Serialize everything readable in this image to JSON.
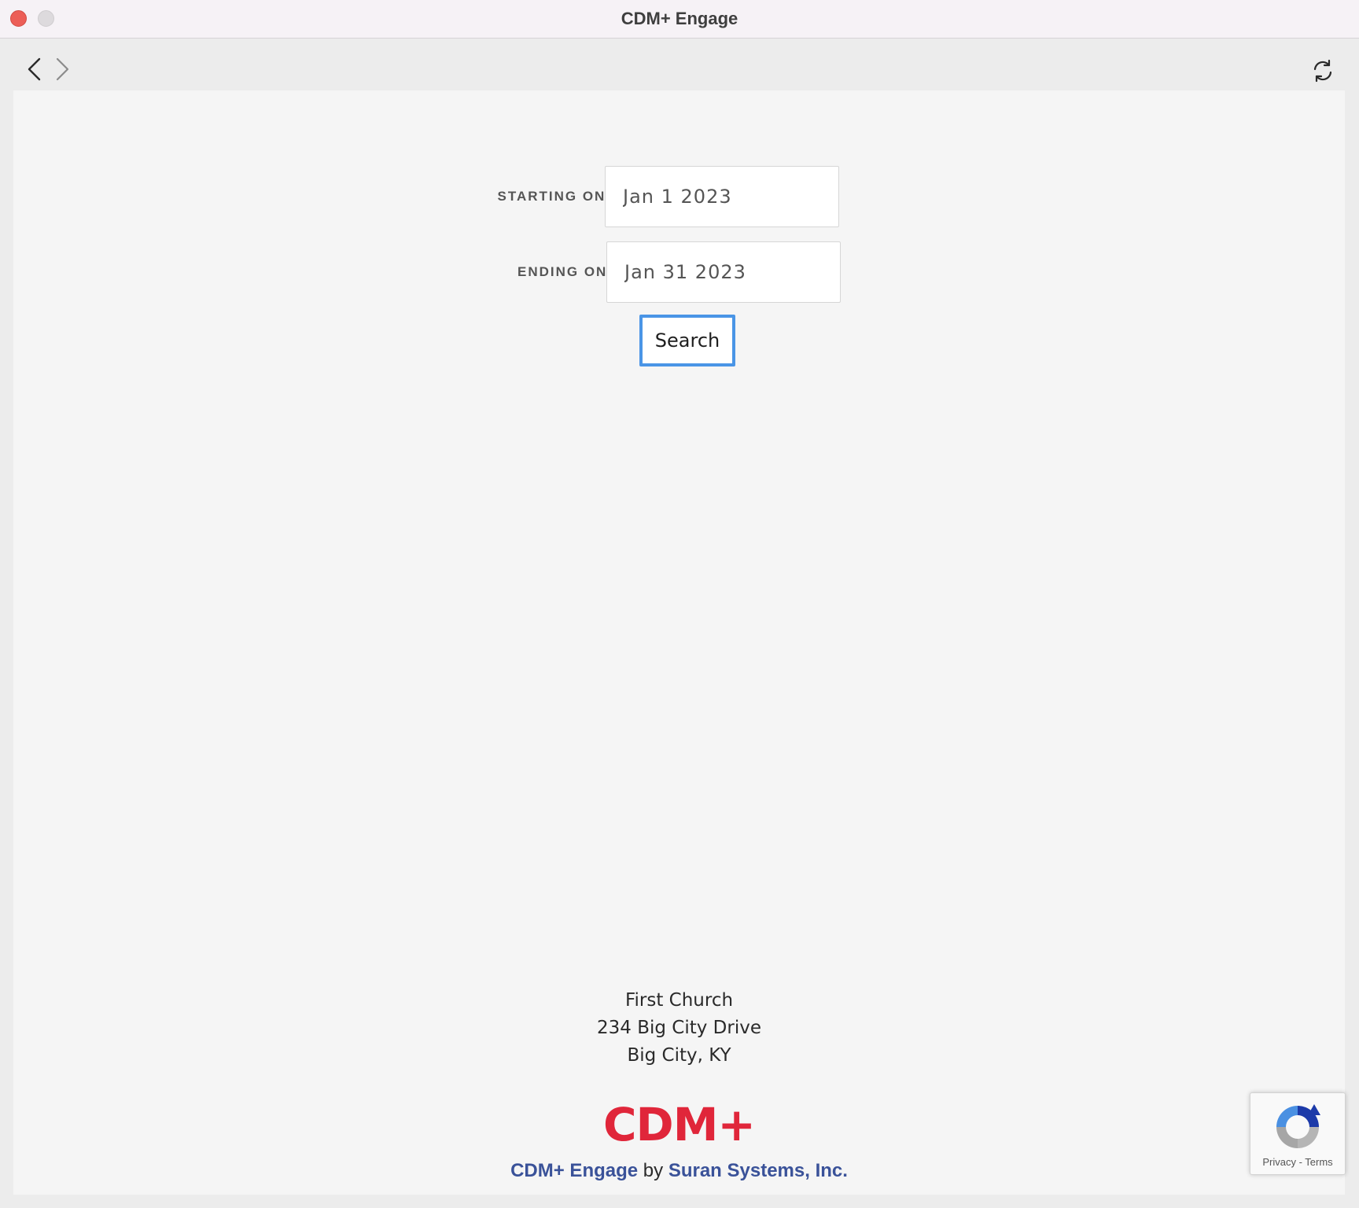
{
  "window": {
    "title": "CDM+ Engage"
  },
  "toolbar": {
    "back_icon": "chevron-left-icon",
    "forward_icon": "chevron-right-icon",
    "reload_icon": "reload-icon"
  },
  "form": {
    "starting_label": "STARTING ON:",
    "starting_value": "Jan 1 2023",
    "ending_label": "ENDING ON:",
    "ending_value": "Jan 31 2023",
    "search_label": "Search"
  },
  "address": {
    "line1": "First Church",
    "line2": "234 Big City Drive",
    "line3": "Big City, KY"
  },
  "footer": {
    "logo_text": "CDM+",
    "product_link": "CDM+ Engage",
    "by": " by ",
    "company_link": "Suran Systems, Inc."
  },
  "recaptcha": {
    "privacy": "Privacy",
    "separator": " - ",
    "terms": "Terms"
  },
  "colors": {
    "accent_focus": "#4a95e6",
    "logo_red": "#e0263a",
    "link_blue": "#3a5299",
    "close_red": "#ec5e57"
  }
}
